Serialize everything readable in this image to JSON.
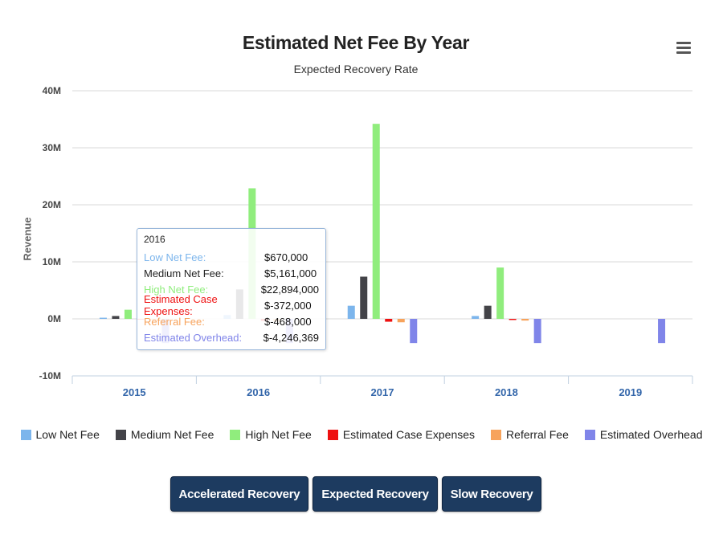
{
  "chart_data": {
    "type": "bar",
    "title": "Estimated Net Fee By Year",
    "subtitle": "Expected Recovery Rate",
    "ylabel": "Revenue",
    "xlabel": "",
    "ylim": [
      -10000000,
      40000000
    ],
    "yticks": [
      {
        "value": 40000000,
        "label": "40M"
      },
      {
        "value": 30000000,
        "label": "30M"
      },
      {
        "value": 20000000,
        "label": "20M"
      },
      {
        "value": 10000000,
        "label": "10M"
      },
      {
        "value": 0,
        "label": "0M"
      },
      {
        "value": -10000000,
        "label": "-10M"
      }
    ],
    "categories": [
      "2015",
      "2016",
      "2017",
      "2018",
      "2019"
    ],
    "grid": true,
    "legend_position": "bottom",
    "series": [
      {
        "name": "Low Net Fee",
        "color": "#7cb5ec",
        "values": [
          200000,
          670000,
          2300000,
          500000,
          0
        ]
      },
      {
        "name": "Medium Net Fee",
        "color": "#434348",
        "values": [
          500000,
          5161000,
          7400000,
          2300000,
          0
        ]
      },
      {
        "name": "High Net Fee",
        "color": "#90ed7d",
        "values": [
          1600000,
          22894000,
          34200000,
          9000000,
          0
        ]
      },
      {
        "name": "Estimated Case Expenses",
        "color": "#ee1111",
        "values": [
          -100000,
          -372000,
          -500000,
          -200000,
          0
        ]
      },
      {
        "name": "Referral Fee",
        "color": "#f7a35c",
        "values": [
          -150000,
          -468000,
          -600000,
          -300000,
          0
        ]
      },
      {
        "name": "Estimated Overhead",
        "color": "#8085e9",
        "values": [
          -4246369,
          -4246369,
          -4246369,
          -4246369,
          -4246369
        ]
      }
    ]
  },
  "tooltip": {
    "header": "2016",
    "rows": [
      {
        "name": "Low Net Fee:",
        "value": "$670,000",
        "color": "#7cb5ec"
      },
      {
        "name": "Medium Net Fee:",
        "value": "$5,161,000",
        "color": "#222222"
      },
      {
        "name": "High Net Fee:",
        "value": "$22,894,000",
        "color": "#90ed7d"
      },
      {
        "name": "Estimated Case Expenses:",
        "value": "$-372,000",
        "color": "#ee1111"
      },
      {
        "name": "Referral Fee:",
        "value": "$-468,000",
        "color": "#f7a35c"
      },
      {
        "name": "Estimated Overhead:",
        "value": "$-4,246,369",
        "color": "#8085e9"
      }
    ]
  },
  "buttons": {
    "accelerated": "Accelerated Recovery",
    "expected": "Expected Recovery",
    "slow": "Slow Recovery"
  },
  "menu_icon": "hamburger-menu-icon"
}
